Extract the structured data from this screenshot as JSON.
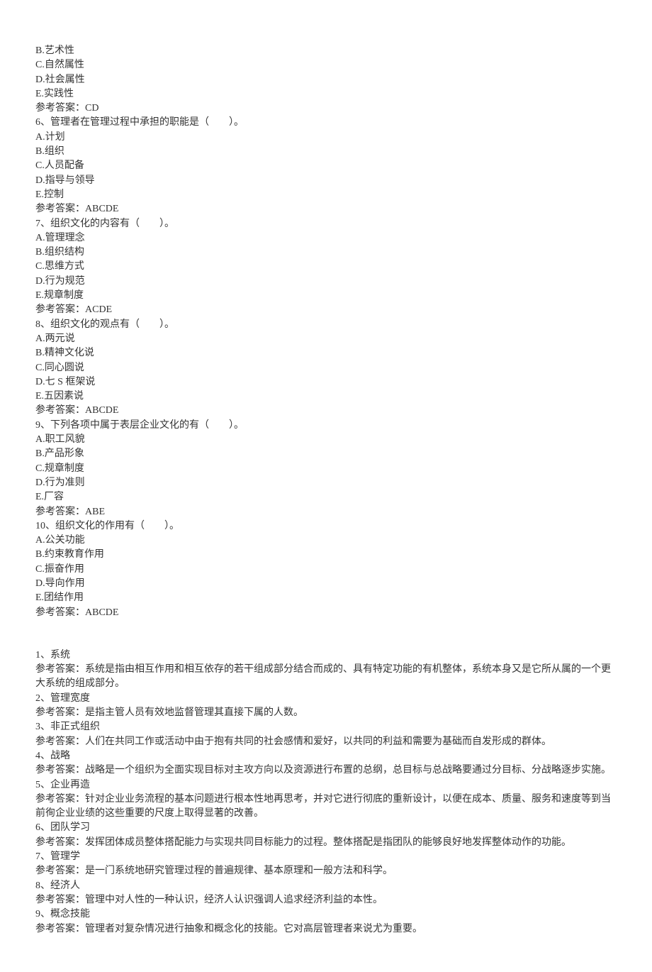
{
  "mcq": [
    {
      "stem_continued": [
        "B.艺术性",
        "C.自然属性",
        "D.社会属性",
        "E.实践性"
      ],
      "answer": "参考答案：CD"
    },
    {
      "question": "6、管理者在管理过程中承担的职能是（　　）。",
      "options": [
        "A.计划",
        "B.组织",
        "C.人员配备",
        "D.指导与领导",
        "E.控制"
      ],
      "answer": "参考答案：ABCDE"
    },
    {
      "question": "7、组织文化的内容有（　　）。",
      "options": [
        "A.管理理念",
        "B.组织结构",
        "C.思维方式",
        "D.行为规范",
        "E.规章制度"
      ],
      "answer": "参考答案：ACDE"
    },
    {
      "question": "8、组织文化的观点有（　　）。",
      "options": [
        "A.两元说",
        "B.精神文化说",
        "C.同心圆说",
        "D.七 S 框架说",
        "E.五因素说"
      ],
      "answer": "参考答案：ABCDE"
    },
    {
      "question": "9、下列各项中属于表层企业文化的有（　　）。",
      "options": [
        "A.职工风貌",
        "B.产品形象",
        "C.规章制度",
        "D.行为准则",
        "E.厂容"
      ],
      "answer": "参考答案：ABE"
    },
    {
      "question": "10、组织文化的作用有（　　）。",
      "options": [
        "A.公关功能",
        "B.约束教育作用",
        "C.振奋作用",
        "D.导向作用",
        "E.团结作用"
      ],
      "answer": "参考答案：ABCDE"
    }
  ],
  "definitions": [
    {
      "term": "1、系统",
      "answer": "参考答案：系统是指由相互作用和相互依存的若干组成部分结合而成的、具有特定功能的有机整体，系统本身又是它所从属的一个更大系统的组成部分。"
    },
    {
      "term": "2、管理宽度",
      "answer": "参考答案：是指主管人员有效地监督管理其直接下属的人数。"
    },
    {
      "term": "3、非正式组织",
      "answer": "参考答案：人们在共同工作或活动中由于抱有共同的社会感情和爱好，以共同的利益和需要为基础而自发形成的群体。"
    },
    {
      "term": "4、战略",
      "answer": "参考答案：战略是一个组织为全面实现目标对主攻方向以及资源进行布置的总纲，总目标与总战略要通过分目标、分战略逐步实施。"
    },
    {
      "term": "5、企业再造",
      "answer": "参考答案：针对企业业务流程的基本问题进行根本性地再思考，并对它进行彻底的重新设计，以便在成本、质量、服务和速度等到当前徇企业业绩的这些重要的尺度上取得显著的改善。"
    },
    {
      "term": "6、团队学习",
      "answer": "参考答案：发挥团体成员整体搭配能力与实现共同目标能力的过程。整体搭配是指团队的能够良好地发挥整体动作的功能。"
    },
    {
      "term": "7、管理学",
      "answer": "参考答案：是一门系统地研究管理过程的普遍规律、基本原理和一般方法和科学。"
    },
    {
      "term": "8、经济人",
      "answer": "参考答案：管理中对人性的一种认识，经济人认识强调人追求经济利益的本性。"
    },
    {
      "term": "9、概念技能",
      "answer": "参考答案：管理者对复杂情况进行抽象和概念化的技能。它对高层管理者来说尤为重要。"
    }
  ]
}
